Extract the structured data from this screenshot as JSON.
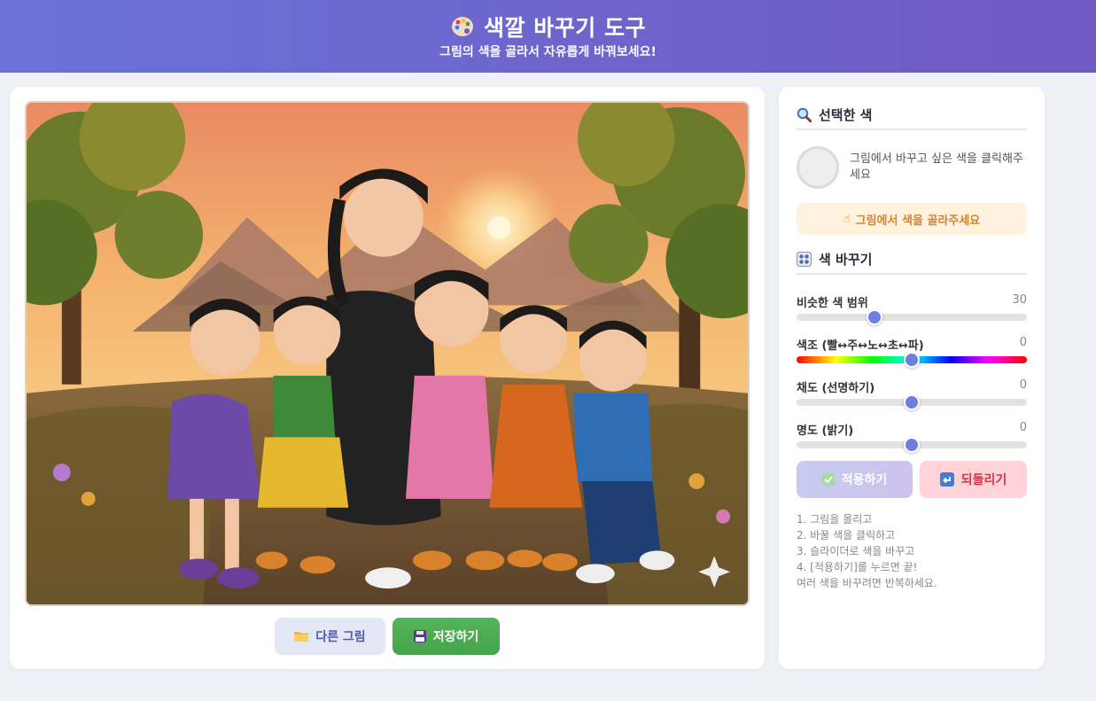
{
  "header": {
    "title": "색깔 바꾸기 도구",
    "subtitle": "그림의 색을 골라서 자유롭게 바꿔보세요!",
    "icon": "palette-icon"
  },
  "canvas": {
    "image_description_icon": "photo"
  },
  "buttons": {
    "other_image": "다른 그림",
    "save": "저장하기"
  },
  "selected": {
    "heading": "선택한 색",
    "heading_icon": "magnifier-icon",
    "hint": "그림에서 바꾸고 싶은 색을 클릭해주세요",
    "notice": "그림에서 색을 골라주세요",
    "notice_icon": "pointing-hand-icon",
    "swatch_color": "#eeeeee"
  },
  "change": {
    "heading": "색 바꾸기",
    "heading_icon": "control-knobs-icon",
    "sliders": [
      {
        "label": "비슷한 색 범위",
        "value": "30",
        "fraction": 0.34
      },
      {
        "label": "색조 (빨↔주↔노↔초↔파)",
        "value": "0",
        "fraction": 0.5
      },
      {
        "label": "채도 (선명하기)",
        "value": "0",
        "fraction": 0.5
      },
      {
        "label": "명도 (밝기)",
        "value": "0",
        "fraction": 0.5
      }
    ],
    "apply": "적용하기",
    "reset": "되돌리기"
  },
  "instructions": [
    "1. 그림을 올리고",
    "2. 바꿀 색을 클릭하고",
    "3. 슬라이더로 색을 바꾸고",
    "4. [적용하기]를 누르면 끝!",
    "여러 색을 바꾸려면 반복하세요."
  ],
  "colors": {
    "accent": "#6b7fe0",
    "save_green": "#4caf50",
    "reset_red": "#d6334a",
    "notice_bg": "#fff3e0"
  }
}
